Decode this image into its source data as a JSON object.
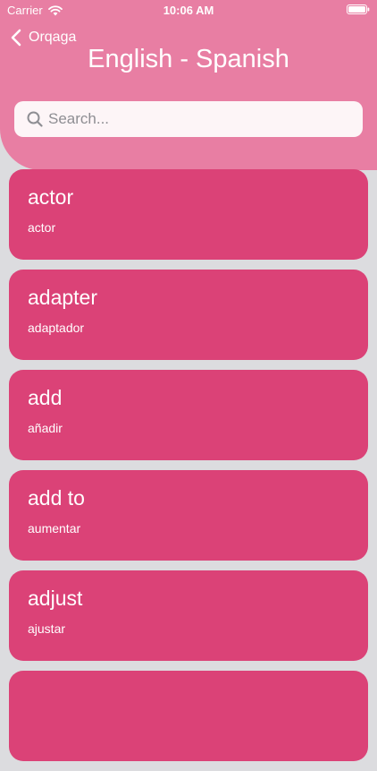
{
  "status_bar": {
    "carrier": "Carrier",
    "time": "10:06 AM"
  },
  "nav": {
    "back_label": "Orqaga",
    "title": "English - Spanish"
  },
  "search": {
    "placeholder": "Search...",
    "value": ""
  },
  "colors": {
    "header": "#e87ea3",
    "card": "#db4277",
    "background": "#dcdcdf"
  },
  "words": [
    {
      "word": "actor",
      "translation": "actor"
    },
    {
      "word": "adapter",
      "translation": "adaptador"
    },
    {
      "word": "add",
      "translation": "añadir"
    },
    {
      "word": "add to",
      "translation": "aumentar"
    },
    {
      "word": "adjust",
      "translation": "ajustar"
    },
    {
      "word": "",
      "translation": ""
    }
  ]
}
